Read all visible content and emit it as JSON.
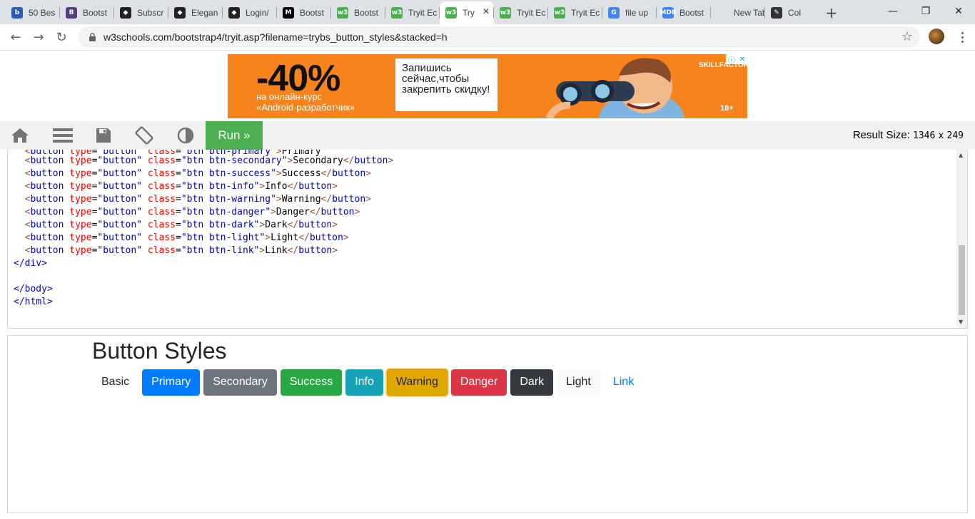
{
  "browser": {
    "tabs": [
      {
        "title": "50 Bes",
        "fav_text": "b",
        "fav_color": "#2a5db0"
      },
      {
        "title": "Bootst",
        "fav_text": "B",
        "fav_color": "#563d7c"
      },
      {
        "title": "Subscr",
        "fav_text": "◆",
        "fav_color": "#222222"
      },
      {
        "title": "Elegan",
        "fav_text": "◆",
        "fav_color": "#222222"
      },
      {
        "title": "Login/",
        "fav_text": "◆",
        "fav_color": "#222222"
      },
      {
        "title": "Bootst",
        "fav_text": "M",
        "fav_color": "#000000"
      },
      {
        "title": "Bootst",
        "fav_text": "w3",
        "fav_color": "#4caf50"
      },
      {
        "title": "Tryit Ec",
        "fav_text": "w3",
        "fav_color": "#4caf50"
      },
      {
        "title": "Try",
        "fav_text": "w3",
        "fav_color": "#4caf50",
        "active": true
      },
      {
        "title": "Tryit Ec",
        "fav_text": "w3",
        "fav_color": "#4caf50"
      },
      {
        "title": "Tryit Ec",
        "fav_text": "w3",
        "fav_color": "#4caf50"
      },
      {
        "title": "file up",
        "fav_text": "G",
        "fav_color": "#4285f4"
      },
      {
        "title": "Bootst",
        "fav_text": "MDB",
        "fav_color": "#4285f4"
      },
      {
        "title": "New Tab",
        "fav_text": "",
        "fav_color": "#dee1e6"
      },
      {
        "title": "Col",
        "fav_text": "✎",
        "fav_color": "#333333"
      }
    ],
    "url": "w3schools.com/bootstrap4/tryit.asp?filename=trybs_button_styles&stacked=h"
  },
  "ad": {
    "headline": "-40%",
    "line1": "на онлайн-курс",
    "line2": "«Android-разработчик»",
    "cta": "Запишись сейчас,чтобы закрепить скидку!",
    "brand": "SKILLFACTORY",
    "age": "18+"
  },
  "tryit": {
    "run_label": "Run »",
    "result_label": "Result Size:",
    "result_width": "1346",
    "result_x": "x",
    "result_height": "249"
  },
  "code": [
    {
      "indent": "  ",
      "cls": "btn btn-secondary",
      "text": "Secondary"
    },
    {
      "indent": "  ",
      "cls": "btn btn-success",
      "text": "Success"
    },
    {
      "indent": "  ",
      "cls": "btn btn-info",
      "text": "Info"
    },
    {
      "indent": "  ",
      "cls": "btn btn-warning",
      "text": "Warning"
    },
    {
      "indent": "  ",
      "cls": "btn btn-danger",
      "text": "Danger"
    },
    {
      "indent": "  ",
      "cls": "btn btn-dark",
      "text": "Dark"
    },
    {
      "indent": "  ",
      "cls": "btn btn-light",
      "text": "Light"
    },
    {
      "indent": "  ",
      "cls": "btn btn-link",
      "text": "Link"
    }
  ],
  "code_tail": {
    "close_div": "</div>",
    "close_body": "</body>",
    "close_html": "</html>"
  },
  "result": {
    "title": "Button Styles",
    "buttons": {
      "basic": "Basic",
      "primary": "Primary",
      "secondary": "Secondary",
      "success": "Success",
      "info": "Info",
      "warning": "Warning",
      "danger": "Danger",
      "dark": "Dark",
      "light": "Light",
      "link": "Link"
    }
  }
}
